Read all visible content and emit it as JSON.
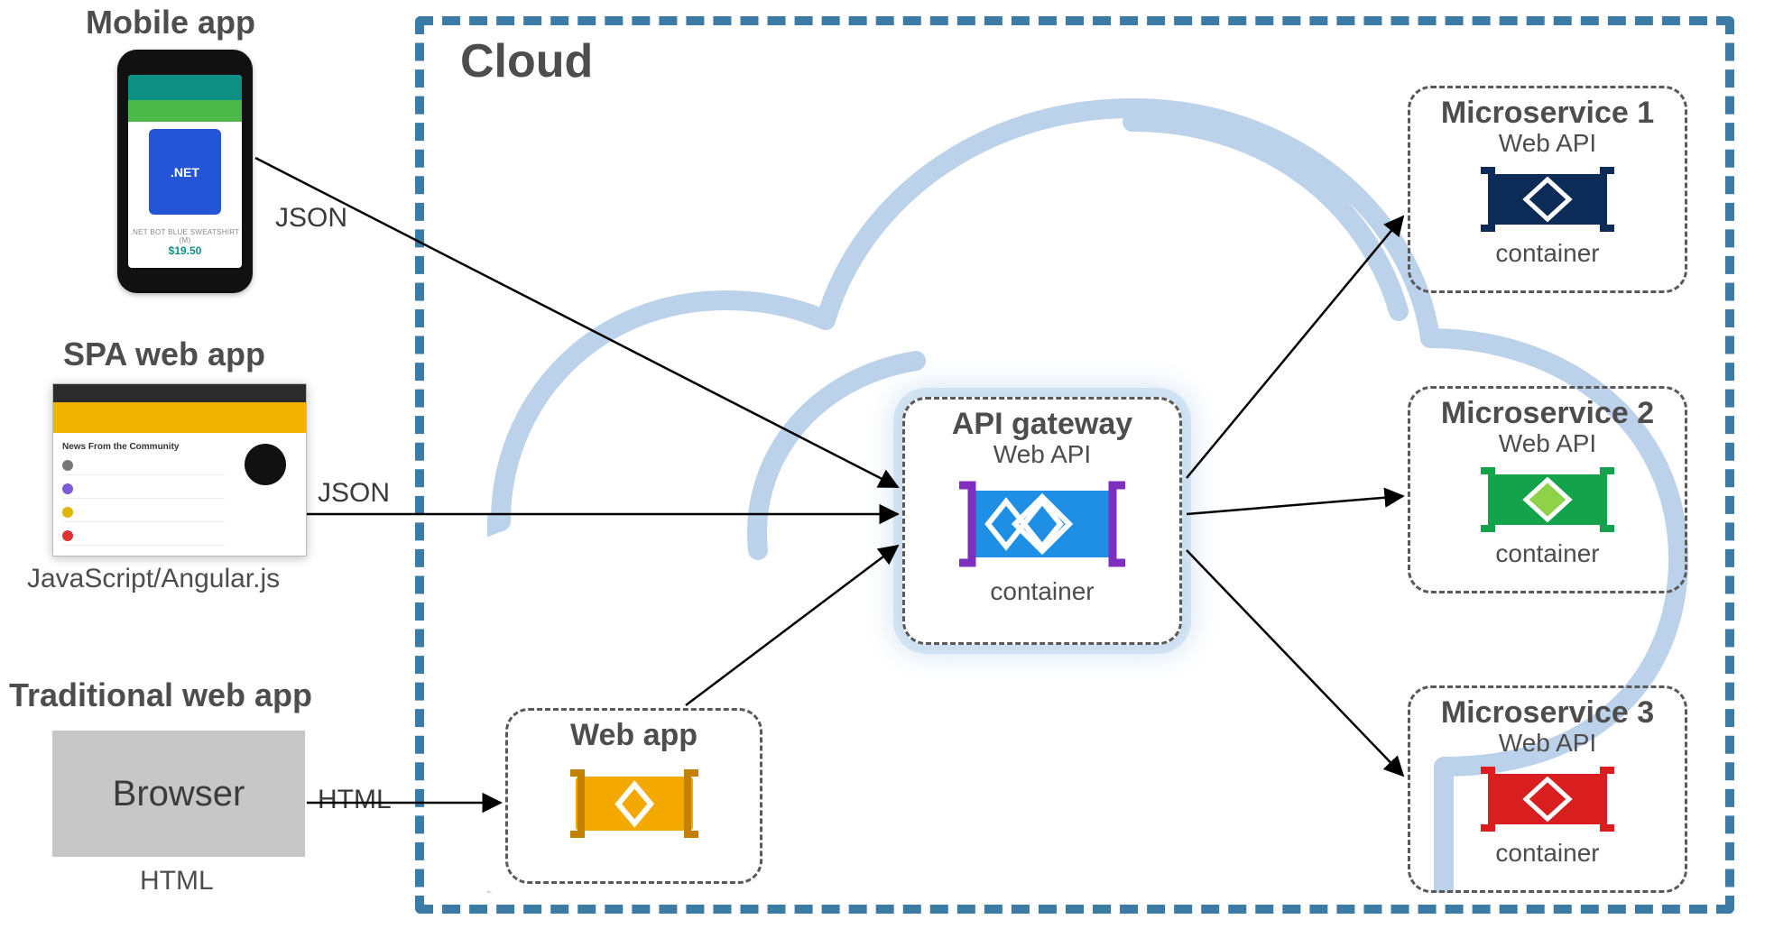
{
  "cloud": {
    "title": "Cloud"
  },
  "clients": {
    "mobile": {
      "title": "Mobile app",
      "edge": "JSON",
      "product_caption": ".NET BOT BLUE SWEATSHIRT (M)",
      "price": "$19.50"
    },
    "spa": {
      "title": "SPA web app",
      "edge": "JSON",
      "caption": "JavaScript/Angular.js",
      "headline": "News From the Community"
    },
    "traditional": {
      "title": "Traditional web app",
      "edge": "HTML",
      "box": "Browser",
      "caption": "HTML"
    }
  },
  "services": {
    "webapp": {
      "title": "Web app"
    },
    "gateway": {
      "title": "API gateway",
      "api": "Web API",
      "foot": "container",
      "color": "#1f8fe6",
      "accent": "#7e2fbf"
    },
    "ms1": {
      "title": "Microservice 1",
      "api": "Web API",
      "foot": "container",
      "color": "#0c2b57",
      "accent": "#0c2b57"
    },
    "ms2": {
      "title": "Microservice 2",
      "api": "Web API",
      "foot": "container",
      "color": "#14a24a",
      "accent": "#14a24a",
      "hex": "#8fd24a"
    },
    "ms3": {
      "title": "Microservice 3",
      "api": "Web API",
      "foot": "container",
      "color": "#d81e1e",
      "accent": "#d81e1e"
    }
  }
}
